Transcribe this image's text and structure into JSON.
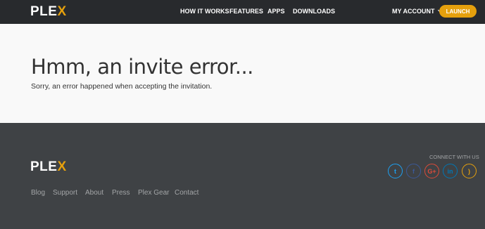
{
  "brand": {
    "logo_prefix": "PLE",
    "logo_x": "X",
    "accent": "#e5a00d"
  },
  "topnav": {
    "links": [
      "HOW IT WORKS",
      "FEATURES",
      "APPS",
      "DOWNLOADS"
    ],
    "account_label": "MY ACCOUNT",
    "launch_label": "LAUNCH"
  },
  "main": {
    "title": "Hmm, an invite error...",
    "message": "Sorry, an error happened when accepting the invitation."
  },
  "footer": {
    "links": [
      "Blog",
      "Support",
      "About",
      "Press",
      "Plex Gear",
      "Contact"
    ],
    "connect_label": "CONNECT WITH US",
    "social": [
      {
        "icon": "twitter-icon",
        "glyph": "t",
        "color": "#1da1f2"
      },
      {
        "icon": "facebook-icon",
        "glyph": "f",
        "color": "#3b5998"
      },
      {
        "icon": "google-plus-icon",
        "glyph": "G+",
        "color": "#dd4b39"
      },
      {
        "icon": "linkedin-icon",
        "glyph": "in",
        "color": "#0077b5"
      },
      {
        "icon": "rss-icon",
        "glyph": ")",
        "color": "#e5a00d"
      }
    ]
  }
}
